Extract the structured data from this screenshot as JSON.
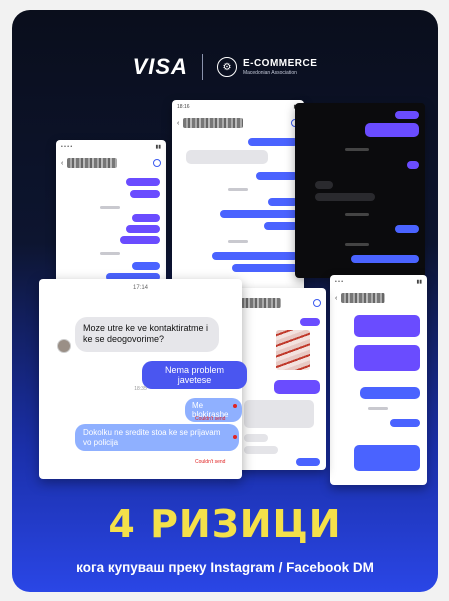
{
  "header": {
    "brand": "VISA",
    "partner_title": "E-COMMERCE",
    "partner_subtitle": "Macedonian Association"
  },
  "front_chat": {
    "time": "17:14",
    "received_message": "Moze utre ke ve kontaktiratme i ke se deogovorime?",
    "sent_message": "Nema problem javetese",
    "mid_time": "18:35",
    "failed_message_1": "Me blokirashe",
    "failed_status_1": "Couldn't send",
    "failed_message_2": "Dokolku ne sredite stoa ke se prijavam vo policija",
    "failed_status_2": "Couldn't send"
  },
  "headline": "4 РИЗИЦИ",
  "subheadline": "кога купуваш преку Instagram / Facebook DM"
}
